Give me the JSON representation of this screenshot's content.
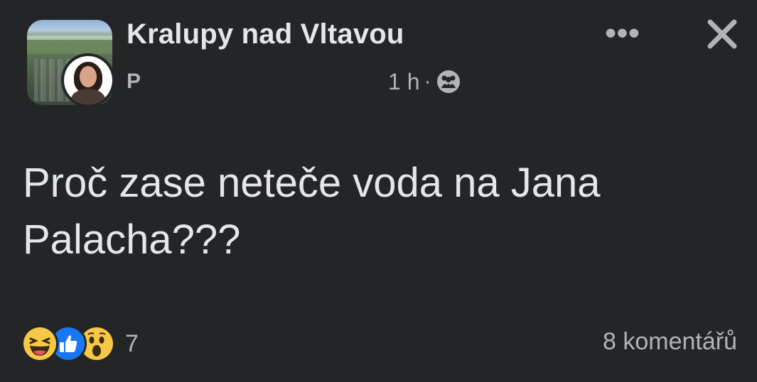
{
  "post": {
    "group_name": "Kralupy nad Vltavou",
    "author": "P",
    "time": "1 h",
    "separator": "·",
    "audience_icon": "public-group-icon",
    "more_label": "•••",
    "close_icon": "close-icon",
    "text_line1": "Proč zase neteče voda na Jana",
    "text_line2": "Palacha???"
  },
  "reactions": {
    "icons": [
      "haha-icon",
      "like-icon",
      "wow-icon"
    ],
    "count": "7"
  },
  "comments": {
    "label": "8 komentářů"
  },
  "colors": {
    "background": "#242526",
    "primary_text": "#e4e6eb",
    "secondary_text": "#b0b3b8",
    "like_blue": "#1877f2",
    "emoji_yellow": "#f7c845"
  }
}
